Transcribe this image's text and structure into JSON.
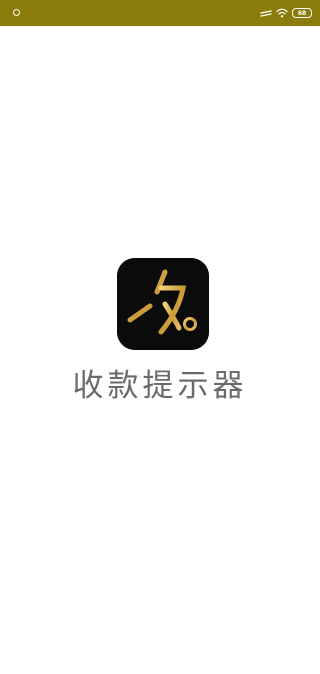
{
  "status_bar": {
    "battery_level": "68",
    "background_color": "#8a7c0a",
    "icons": [
      "notification-dot-icon",
      "signal-icon",
      "wifi-icon",
      "battery-icon"
    ]
  },
  "splash": {
    "app_name": "收款提示器",
    "logo_icon": "shou-logo-icon",
    "logo_background": "#0b0b0b",
    "logo_accent": "#d8ad4a"
  }
}
